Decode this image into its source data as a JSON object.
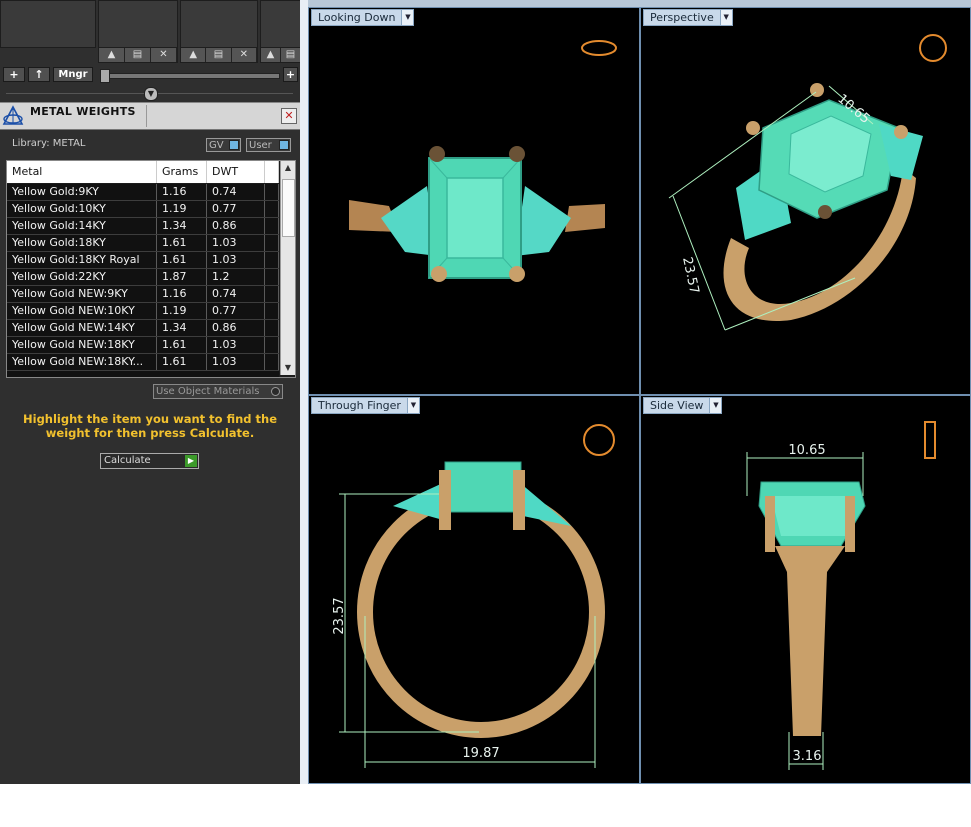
{
  "toolbar": {
    "add_label": "+",
    "up_label": "↑",
    "manager_label": "Mngr",
    "zoom_plus_label": "+"
  },
  "panel": {
    "title": "METAL WEIGHTS",
    "library_label": "Library: METAL",
    "toggle_gv": "GV",
    "toggle_user": "User",
    "columns": [
      "Metal",
      "Grams",
      "DWT"
    ],
    "rows": [
      [
        "Yellow Gold:9KY",
        "1.16",
        "0.74"
      ],
      [
        "Yellow Gold:10KY",
        "1.19",
        "0.77"
      ],
      [
        "Yellow Gold:14KY",
        "1.34",
        "0.86"
      ],
      [
        "Yellow Gold:18KY",
        "1.61",
        "1.03"
      ],
      [
        "Yellow Gold:18KY Royal",
        "1.61",
        "1.03"
      ],
      [
        "Yellow Gold:22KY",
        "1.87",
        "1.2"
      ],
      [
        "Yellow Gold NEW:9KY",
        "1.16",
        "0.74"
      ],
      [
        "Yellow Gold NEW:10KY",
        "1.19",
        "0.77"
      ],
      [
        "Yellow Gold NEW:14KY",
        "1.34",
        "0.86"
      ],
      [
        "Yellow Gold NEW:18KY",
        "1.61",
        "1.03"
      ],
      [
        "Yellow Gold NEW:18KY...",
        "1.61",
        "1.03"
      ]
    ],
    "use_object_materials": "Use Object Materials",
    "hint": "Highlight the item you want to find the weight for then press Calculate.",
    "calculate_label": "Calculate",
    "close_icon": "close-icon"
  },
  "viewports": {
    "top_left": {
      "label": "Looking Down"
    },
    "top_right": {
      "label": "Perspective",
      "dim_a": "10.65",
      "dim_b": "23.57"
    },
    "bottom_left": {
      "label": "Through Finger",
      "dim_height": "23.57",
      "dim_width": "19.87"
    },
    "bottom_right": {
      "label": "Side View",
      "dim_top": "10.65",
      "dim_bottom": "3.16"
    }
  },
  "colors": {
    "gold": "#c9a06a",
    "gem": "#5fe0c0",
    "dimension": "#aef0bf",
    "hint": "#f2c12e"
  }
}
